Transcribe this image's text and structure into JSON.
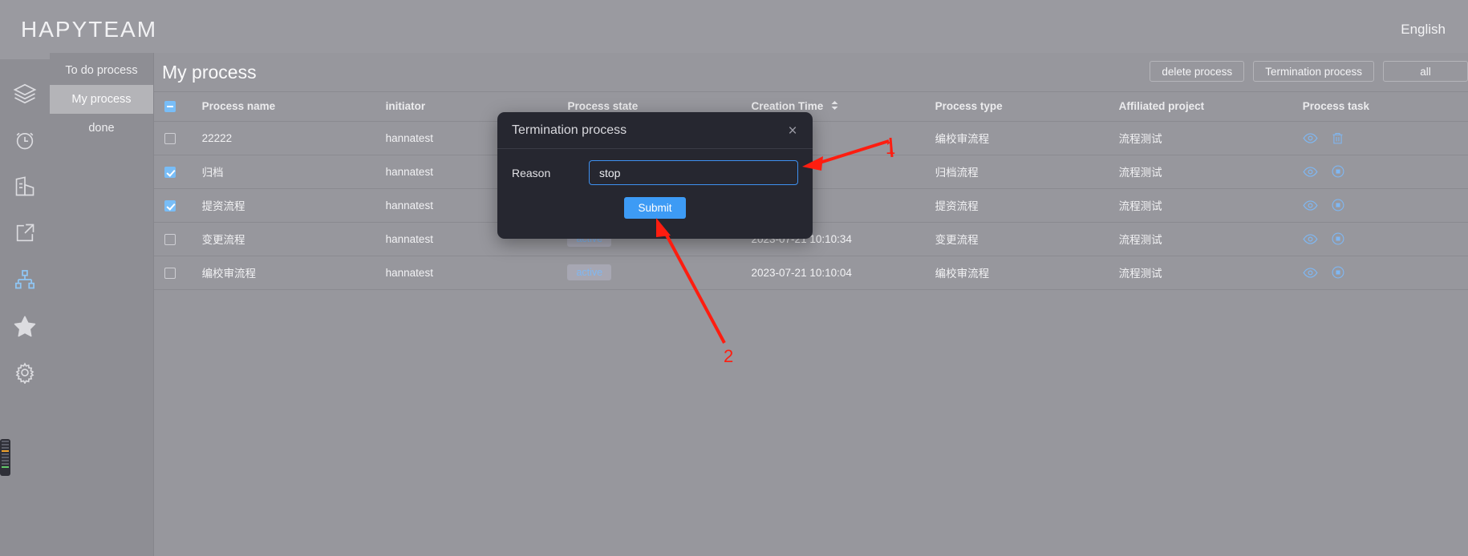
{
  "header": {
    "brand": "HAPYTEAM",
    "language": "English"
  },
  "rail": {
    "items": [
      {
        "name": "layers-icon",
        "label": "layers"
      },
      {
        "name": "clock-icon",
        "label": "clock"
      },
      {
        "name": "building-icon",
        "label": "building"
      },
      {
        "name": "share-icon",
        "label": "share"
      },
      {
        "name": "sitemap-icon",
        "label": "sitemap",
        "active": true
      },
      {
        "name": "star-icon",
        "label": "star"
      },
      {
        "name": "gear-icon",
        "label": "settings"
      }
    ],
    "active_color": "#8fc6f5",
    "inactive_color": "#dcdce0"
  },
  "subnav": {
    "items": [
      {
        "label": "To do process",
        "active": false
      },
      {
        "label": "My process",
        "active": true
      },
      {
        "label": "done",
        "active": false
      }
    ]
  },
  "main": {
    "title": "My process",
    "actions": [
      {
        "label": "delete process",
        "name": "delete-process-button"
      },
      {
        "label": "Termination process",
        "name": "termination-process-button"
      },
      {
        "label": "all",
        "name": "all-filter-button"
      }
    ]
  },
  "table": {
    "headers": [
      "Process name",
      "initiator",
      "Process state",
      "Creation Time",
      "Process type",
      "Affiliated project",
      "Process task"
    ],
    "header_checkbox_state": "indeterminate",
    "sort_column": "Creation Time",
    "rows": [
      {
        "checked": false,
        "name": "22222",
        "initiator": "hannatest",
        "state": "",
        "time": "",
        "type": "编校审流程",
        "project": "流程测试",
        "actions": [
          "view-icon",
          "delete-icon"
        ]
      },
      {
        "checked": true,
        "name": "归档",
        "initiator": "hannatest",
        "state": "",
        "time": "",
        "type": "归档流程",
        "project": "流程测试",
        "actions": [
          "view-icon",
          "stop-icon"
        ]
      },
      {
        "checked": true,
        "name": "提资流程",
        "initiator": "hannatest",
        "state": "",
        "time": "",
        "type": "提资流程",
        "project": "流程测试",
        "actions": [
          "view-icon",
          "stop-icon"
        ]
      },
      {
        "checked": false,
        "name": "变更流程",
        "initiator": "hannatest",
        "state": "active",
        "time": "2023-07-21 10:10:34",
        "type": "变更流程",
        "project": "流程测试",
        "actions": [
          "view-icon",
          "stop-icon"
        ]
      },
      {
        "checked": false,
        "name": "编校审流程",
        "initiator": "hannatest",
        "state": "active",
        "time": "2023-07-21 10:10:04",
        "type": "编校审流程",
        "project": "流程测试",
        "actions": [
          "view-icon",
          "stop-icon"
        ]
      }
    ]
  },
  "modal": {
    "title": "Termination process",
    "close_label": "×",
    "reason_label": "Reason",
    "reason_value": "stop",
    "submit_label": "Submit"
  },
  "annotations": [
    {
      "label": "1",
      "target": "reason-input"
    },
    {
      "label": "2",
      "target": "submit-button"
    }
  ],
  "colors": {
    "accent_blue": "#3d9bf5",
    "annotation_red": "#fe1d10",
    "page_bg": "#97979d",
    "modal_bg": "#262730"
  }
}
